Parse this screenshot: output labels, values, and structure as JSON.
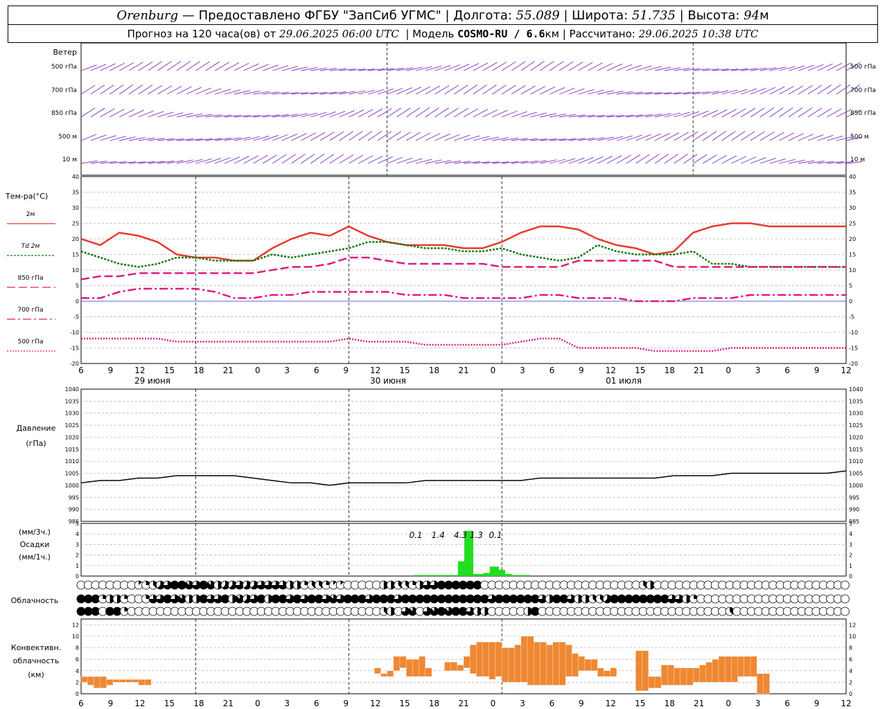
{
  "header": {
    "city": "Orenburg",
    "provided_by": "— Предоставлено ФГБУ \"ЗапСиб УГМС\"",
    "lon_label": "Долгота:",
    "lon": "55.089",
    "lat_label": "Широта:",
    "lat": "51.735",
    "alt_label": "Высота:",
    "alt": "94",
    "alt_unit": "м",
    "forecast_label": "Прогноз на 120 часа(ов) от",
    "forecast_time": "29.06.2025 06:00 UTC",
    "model_label": "Модель",
    "model": "COSMO-RU / 6.6",
    "model_unit": "км",
    "calc_label": "Рассчитано:",
    "calc_time": "29.06.2025 10:38 UTC"
  },
  "colors": {
    "t2m": "#e8392e",
    "td2m": "#0a7a0a",
    "t850": "#e0197a",
    "t700": "#e0197a",
    "t500": "#e0197a",
    "wind": "#7a2fb8",
    "pressure": "#000000",
    "precip": "#22dd22",
    "convective": "#ee8833",
    "zero_line": "#3333ff"
  },
  "time_axis": {
    "hour_ticks": [
      "6",
      "9",
      "12",
      "15",
      "18",
      "21",
      "0",
      "3",
      "6",
      "9",
      "12",
      "15",
      "18",
      "21",
      "0",
      "3",
      "6",
      "9",
      "12",
      "15",
      "18",
      "21",
      "0",
      "3",
      "6",
      "9",
      "12"
    ],
    "dates": [
      "29 июня",
      "30 июня",
      "01 июля"
    ]
  },
  "chart_data": [
    {
      "type": "wind-barbs",
      "title": "Ветер",
      "levels": [
        "500 гПа",
        "700 гПа",
        "850 гПа",
        "500 м",
        "10 м"
      ],
      "x_hours": [
        0,
        120
      ]
    },
    {
      "type": "line",
      "ylabel": "Тем-ра(°C)",
      "ylim": [
        -20,
        40
      ],
      "ytick_step": 5,
      "x": [
        0,
        3,
        6,
        9,
        12,
        15,
        18,
        21,
        24,
        27,
        30,
        33,
        36,
        39,
        42,
        45,
        48,
        51,
        54,
        57,
        60,
        63,
        66,
        69,
        72,
        75,
        78,
        81,
        84,
        87,
        90,
        93,
        96,
        99,
        102,
        105,
        108,
        111,
        114,
        117,
        120
      ],
      "series": [
        {
          "name": "2м",
          "style": "solid",
          "values": [
            20,
            18,
            22,
            21,
            19,
            15,
            14,
            14,
            13,
            13,
            17,
            20,
            22,
            21,
            24,
            21,
            19,
            18,
            18,
            18,
            17,
            17,
            19,
            22,
            24,
            24,
            23,
            20,
            18,
            17,
            15,
            16,
            22,
            24,
            25,
            25,
            24,
            24,
            24,
            24,
            24
          ]
        },
        {
          "name": "Td 2м",
          "style": "dotted",
          "values": [
            16,
            14,
            12,
            11,
            12,
            14,
            14,
            13,
            13,
            13,
            15,
            14,
            15,
            16,
            17,
            19,
            19,
            18,
            17,
            17,
            16,
            16,
            17,
            15,
            14,
            13,
            14,
            18,
            16,
            15,
            15,
            15,
            16,
            12,
            12,
            11,
            11,
            11,
            11,
            11,
            11
          ]
        },
        {
          "name": "850 гПа",
          "style": "dashed",
          "values": [
            7,
            8,
            8,
            9,
            9,
            9,
            9,
            9,
            9,
            9,
            10,
            11,
            11,
            12,
            14,
            14,
            13,
            12,
            12,
            12,
            12,
            12,
            11,
            11,
            11,
            11,
            13,
            13,
            13,
            13,
            13,
            11,
            11,
            11,
            11,
            11,
            11,
            11,
            11,
            11,
            11
          ]
        },
        {
          "name": "700 гПа",
          "style": "dashdot",
          "values": [
            1,
            1,
            3,
            4,
            4,
            4,
            4,
            3,
            1,
            1,
            2,
            2,
            3,
            3,
            3,
            3,
            3,
            2,
            2,
            2,
            1,
            1,
            1,
            1,
            2,
            2,
            1,
            1,
            1,
            0,
            0,
            0,
            1,
            1,
            1,
            2,
            2,
            2,
            2,
            2,
            2
          ]
        },
        {
          "name": "500 гПа",
          "style": "fine-dotted",
          "values": [
            -12,
            -12,
            -12,
            -12,
            -12,
            -13,
            -13,
            -13,
            -13,
            -13,
            -13,
            -13,
            -13,
            -13,
            -12,
            -13,
            -13,
            -13,
            -14,
            -14,
            -14,
            -14,
            -14,
            -13,
            -12,
            -12,
            -15,
            -15,
            -15,
            -15,
            -16,
            -16,
            -16,
            -16,
            -15,
            -15,
            -15,
            -15,
            -15,
            -15,
            -15
          ]
        }
      ]
    },
    {
      "type": "line",
      "ylabel": "Давление",
      "yunit": "(гПа)",
      "ylim": [
        985,
        1040
      ],
      "ytick_step": 5,
      "x": [
        0,
        3,
        6,
        9,
        12,
        15,
        18,
        21,
        24,
        27,
        30,
        33,
        36,
        39,
        42,
        45,
        48,
        51,
        54,
        57,
        60,
        63,
        66,
        69,
        72,
        75,
        78,
        81,
        84,
        87,
        90,
        93,
        96,
        99,
        102,
        105,
        108,
        111,
        114,
        117,
        120
      ],
      "values": [
        1001,
        1002,
        1002,
        1003,
        1003,
        1004,
        1004,
        1004,
        1004,
        1003,
        1002,
        1001,
        1001,
        1000,
        1001,
        1001,
        1001,
        1001,
        1002,
        1002,
        1002,
        1002,
        1002,
        1002,
        1003,
        1003,
        1003,
        1003,
        1003,
        1003,
        1003,
        1004,
        1004,
        1004,
        1005,
        1005,
        1005,
        1005,
        1005,
        1005,
        1006
      ]
    },
    {
      "type": "bar",
      "ylabel": "Осадки",
      "yunit_3h": "(мм/3ч.)",
      "yunit_1h": "(мм/1ч.)",
      "ylim": [
        0,
        5
      ],
      "x_hours": [
        52,
        53,
        54,
        55,
        56,
        57,
        58,
        59,
        60,
        61,
        62,
        63,
        64,
        65,
        66,
        67,
        68,
        69
      ],
      "values": [
        0.1,
        0.1,
        0.1,
        0.1,
        0.1,
        0.1,
        0.1,
        1.4,
        4.3,
        0.2,
        0.2,
        0.3,
        0.9,
        0.6,
        0.2,
        0.1,
        0.1,
        0.1
      ],
      "labels_3h": [
        {
          "x": 52.5,
          "text": "0.1"
        },
        {
          "x": 56.0,
          "text": "1.4"
        },
        {
          "x": 59.5,
          "text": "4.3"
        },
        {
          "x": 62.0,
          "text": "1.3"
        },
        {
          "x": 65.0,
          "text": "0.1"
        }
      ]
    },
    {
      "type": "heatmap",
      "ylabel": "Облачность",
      "rows": 3,
      "cover_octas": [
        [
          0,
          0,
          0,
          0,
          0,
          0,
          0,
          0,
          1,
          2,
          3,
          5,
          6,
          8,
          8,
          7,
          6,
          8,
          7,
          4,
          5,
          5,
          6,
          5,
          5,
          6,
          6,
          6,
          6,
          4,
          4,
          2,
          3,
          3,
          2,
          1,
          1,
          0,
          0,
          0,
          0,
          0,
          4,
          4,
          3,
          3,
          2,
          4,
          6,
          6,
          8,
          8,
          8,
          8,
          8,
          8,
          0,
          0,
          0,
          0,
          0,
          0,
          0,
          0,
          0,
          0,
          0,
          0,
          0,
          0,
          0,
          0,
          0,
          0,
          0,
          0,
          0,
          0,
          3,
          4,
          0,
          0,
          0,
          0,
          0,
          0,
          0,
          0,
          0,
          0,
          0,
          0,
          0,
          0,
          0,
          0,
          0,
          0,
          0,
          0,
          0,
          0,
          0,
          0,
          0,
          0,
          0
        ],
        [
          8,
          8,
          8,
          2,
          4,
          4,
          2,
          0,
          0,
          2,
          6,
          6,
          8,
          6,
          7,
          4,
          4,
          8,
          6,
          6,
          8,
          4,
          7,
          5,
          6,
          8,
          4,
          8,
          8,
          6,
          8,
          6,
          8,
          8,
          6,
          7,
          6,
          8,
          8,
          8,
          6,
          8,
          8,
          8,
          6,
          8,
          8,
          8,
          8,
          8,
          8,
          8,
          8,
          8,
          8,
          8,
          8,
          6,
          8,
          8,
          8,
          8,
          8,
          8,
          6,
          4,
          8,
          8,
          6,
          4,
          4,
          3,
          3,
          5,
          8,
          8,
          8,
          8,
          8,
          8,
          8,
          8,
          6,
          6,
          4,
          2,
          0,
          0,
          0,
          0,
          0,
          0,
          0,
          0,
          0,
          0,
          0,
          0,
          0,
          0,
          0,
          0,
          0,
          0,
          0,
          0,
          0
        ],
        [
          8,
          8,
          8,
          0,
          8,
          8,
          2,
          0,
          0,
          0,
          0,
          0,
          0,
          0,
          0,
          0,
          0,
          0,
          0,
          0,
          0,
          0,
          0,
          0,
          0,
          0,
          0,
          0,
          0,
          0,
          0,
          0,
          0,
          0,
          0,
          0,
          0,
          0,
          0,
          0,
          0,
          0,
          3,
          4,
          0,
          6,
          7,
          0,
          6,
          7,
          8,
          7,
          8,
          8,
          6,
          4,
          4,
          0,
          0,
          0,
          0,
          0,
          4,
          8,
          0,
          0,
          0,
          0,
          0,
          0,
          0,
          0,
          0,
          0,
          0,
          0,
          0,
          0,
          0,
          0,
          0,
          0,
          0,
          0,
          0,
          0,
          0,
          0,
          0,
          0,
          3,
          0,
          0,
          0,
          0,
          0,
          0,
          0,
          0,
          0,
          0,
          0,
          0,
          0,
          0,
          0,
          0
        ]
      ]
    },
    {
      "type": "bar",
      "ylabel": "Конвективн. облачность (км)",
      "ylim": [
        0,
        13
      ],
      "ytick_step": 2,
      "x_hours": [
        0,
        1,
        2,
        3,
        4,
        5,
        6,
        7,
        8,
        9,
        10,
        11,
        12,
        13,
        14,
        15,
        16,
        17,
        18,
        19,
        20,
        21,
        22,
        23,
        24,
        25,
        26,
        27,
        28,
        29,
        30,
        31,
        32,
        33,
        34,
        35,
        36,
        37,
        38,
        39,
        40,
        41,
        42,
        43,
        44,
        45,
        46,
        47,
        48,
        49,
        50,
        51,
        52,
        53,
        54,
        55,
        56,
        57,
        58,
        59,
        60,
        61,
        62,
        63,
        64,
        65,
        66,
        67,
        68,
        69,
        70,
        71,
        72,
        73,
        74,
        75,
        76,
        77,
        78,
        79,
        80,
        81,
        82,
        83,
        84,
        85,
        86,
        87,
        88,
        89,
        90,
        91,
        92,
        93,
        94,
        95,
        96,
        97,
        98,
        99,
        100,
        101,
        102,
        103,
        104,
        105,
        106,
        107,
        108,
        109,
        110,
        111,
        112,
        113,
        114,
        115,
        116,
        117,
        118,
        119,
        120
      ],
      "bottom": [
        2,
        1.5,
        1,
        1,
        1.5,
        2,
        2,
        2,
        2,
        1.5,
        1.5,
        0,
        0,
        0,
        0,
        0,
        0,
        0,
        0,
        0,
        0,
        0,
        0,
        0,
        0,
        0,
        0,
        0,
        0,
        0,
        0,
        0,
        0,
        0,
        0,
        0,
        0,
        0,
        0,
        0,
        0,
        0,
        0,
        0,
        0,
        0,
        3.5,
        3,
        3,
        4,
        4.5,
        3,
        3,
        3,
        3,
        0,
        0,
        4,
        4,
        4,
        4.5,
        3.5,
        3,
        3,
        2.5,
        3,
        2,
        2,
        2,
        2,
        1.5,
        1.5,
        1.5,
        1.5,
        1.5,
        1.5,
        3,
        3,
        4,
        4,
        4,
        3,
        3,
        3,
        0,
        0,
        0,
        0.5,
        0.5,
        1,
        1,
        1.5,
        1.5,
        1.5,
        1.5,
        1.5,
        2,
        2,
        2,
        2,
        2,
        2,
        2,
        3,
        3,
        3,
        0,
        0,
        0,
        0,
        0,
        0,
        0,
        0,
        0,
        0,
        0,
        0,
        0,
        0,
        0
      ],
      "top": [
        3,
        3,
        3,
        3,
        2.5,
        2.5,
        2.5,
        2.5,
        2.5,
        2.5,
        2.5,
        0,
        0,
        0,
        0,
        0,
        0,
        0,
        0,
        0,
        0,
        0,
        0,
        0,
        0,
        0,
        0,
        0,
        0,
        0,
        0,
        0,
        0,
        0,
        0,
        0,
        0,
        0,
        0,
        0,
        0,
        0,
        0,
        0,
        0,
        0,
        4.5,
        3.5,
        4,
        6.5,
        6.5,
        6,
        6,
        6.5,
        4.5,
        0,
        0,
        5.5,
        5.5,
        5,
        6.5,
        8.5,
        9,
        9,
        9,
        9,
        8,
        8,
        8.5,
        10,
        10,
        9,
        9,
        8.5,
        9,
        9,
        8.5,
        7,
        6.5,
        6,
        6,
        4.5,
        4,
        4.5,
        0,
        0,
        0,
        7.5,
        7.5,
        3,
        3,
        5,
        5,
        4.5,
        4.5,
        4.5,
        4.5,
        5,
        5.5,
        6,
        6.5,
        6.5,
        6.5,
        6.5,
        6.5,
        6.5,
        3.5,
        3.5,
        0,
        0,
        0,
        0,
        0,
        0,
        0,
        0,
        0,
        0,
        0,
        0,
        0,
        0,
        0
      ]
    }
  ]
}
